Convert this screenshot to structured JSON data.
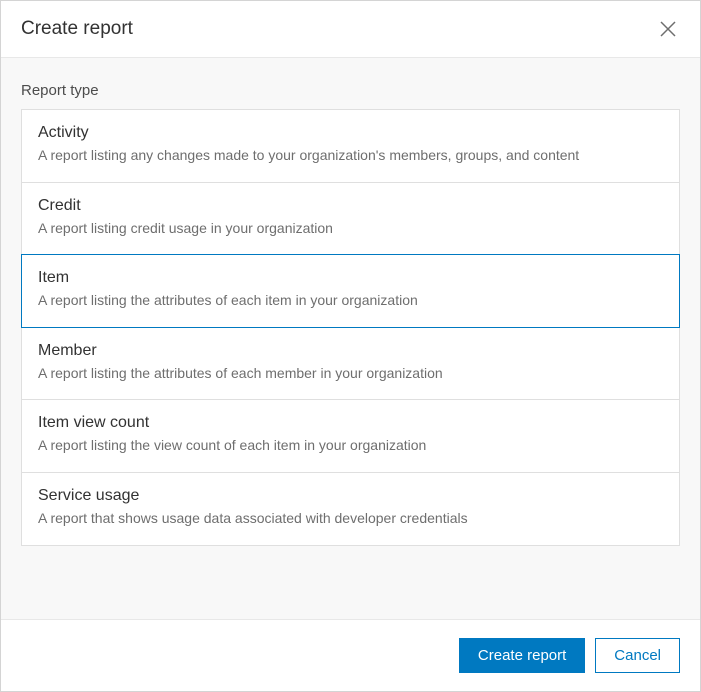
{
  "dialog": {
    "title": "Create report",
    "section_label": "Report type",
    "selected_index": 2,
    "options": [
      {
        "title": "Activity",
        "desc": "A report listing any changes made to your organization's members, groups, and content"
      },
      {
        "title": "Credit",
        "desc": "A report listing credit usage in your organization"
      },
      {
        "title": "Item",
        "desc": "A report listing the attributes of each item in your organization"
      },
      {
        "title": "Member",
        "desc": "A report listing the attributes of each member in your organization"
      },
      {
        "title": "Item view count",
        "desc": "A report listing the view count of each item in your organization"
      },
      {
        "title": "Service usage",
        "desc": "A report that shows usage data associated with developer credentials"
      }
    ],
    "footer": {
      "primary_label": "Create report",
      "secondary_label": "Cancel"
    }
  }
}
